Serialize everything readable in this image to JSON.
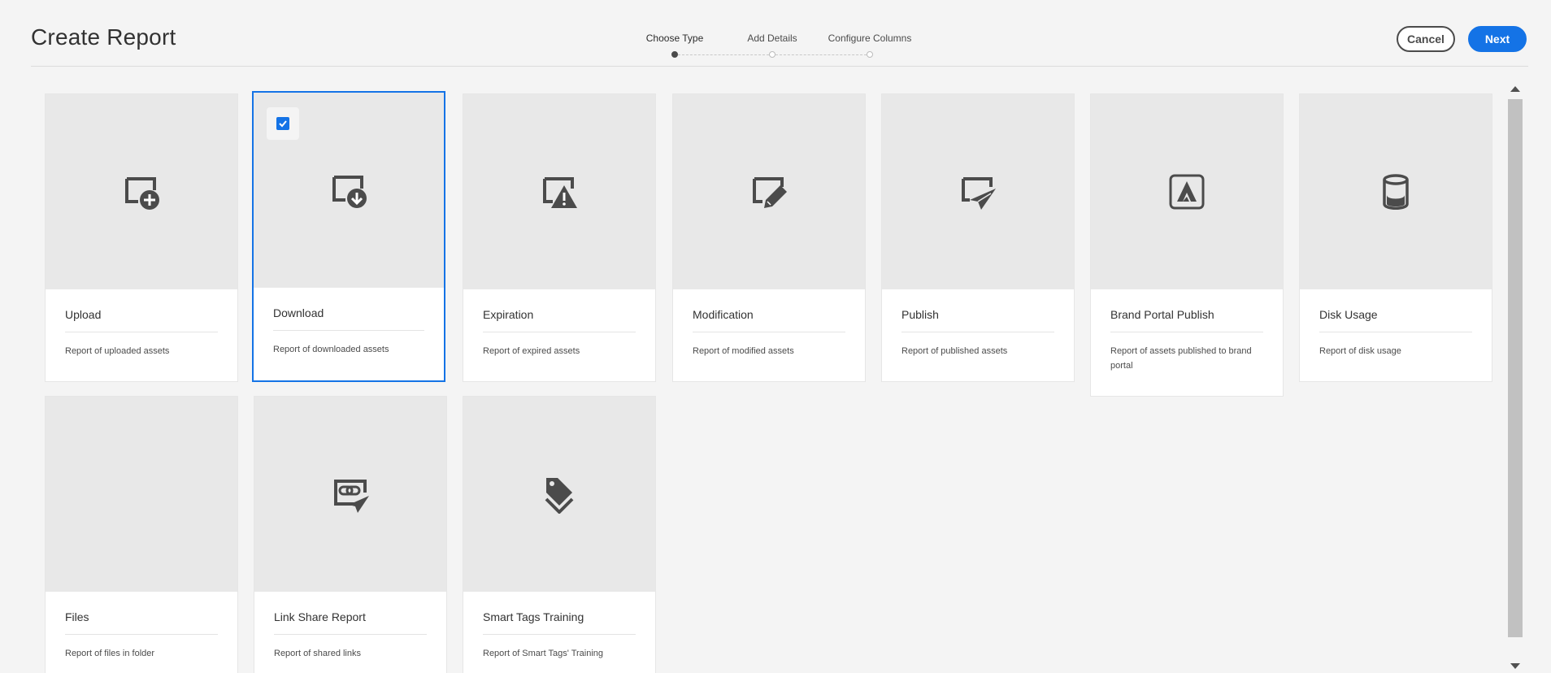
{
  "header": {
    "title": "Create Report",
    "cancel_label": "Cancel",
    "next_label": "Next"
  },
  "stepper": {
    "steps": [
      {
        "label": "Choose Type",
        "active": true
      },
      {
        "label": "Add Details",
        "active": false
      },
      {
        "label": "Configure Columns",
        "active": false
      }
    ]
  },
  "cards": [
    {
      "title": "Upload",
      "description": "Report of uploaded assets",
      "icon": "upload-report-icon",
      "selected": false
    },
    {
      "title": "Download",
      "description": "Report of downloaded assets",
      "icon": "download-report-icon",
      "selected": true
    },
    {
      "title": "Expiration",
      "description": "Report of expired assets",
      "icon": "expiration-report-icon",
      "selected": false
    },
    {
      "title": "Modification",
      "description": "Report of modified assets",
      "icon": "modification-report-icon",
      "selected": false
    },
    {
      "title": "Publish",
      "description": "Report of published assets",
      "icon": "publish-report-icon",
      "selected": false
    },
    {
      "title": "Brand Portal Publish",
      "description": "Report of assets published to brand portal",
      "icon": "brand-portal-icon",
      "selected": false
    },
    {
      "title": "Disk Usage",
      "description": "Report of disk usage",
      "icon": "disk-usage-icon",
      "selected": false
    },
    {
      "title": "Files",
      "description": "Report of files in folder",
      "icon": "",
      "selected": false
    },
    {
      "title": "Link Share Report",
      "description": "Report of shared links",
      "icon": "link-share-icon",
      "selected": false
    },
    {
      "title": "Smart Tags Training",
      "description": "Report of Smart Tags' Training",
      "icon": "smart-tags-icon",
      "selected": false
    }
  ],
  "colors": {
    "accent": "#1473e6",
    "icon": "#4b4b4b",
    "thumb_bg": "#e8e8e8"
  }
}
